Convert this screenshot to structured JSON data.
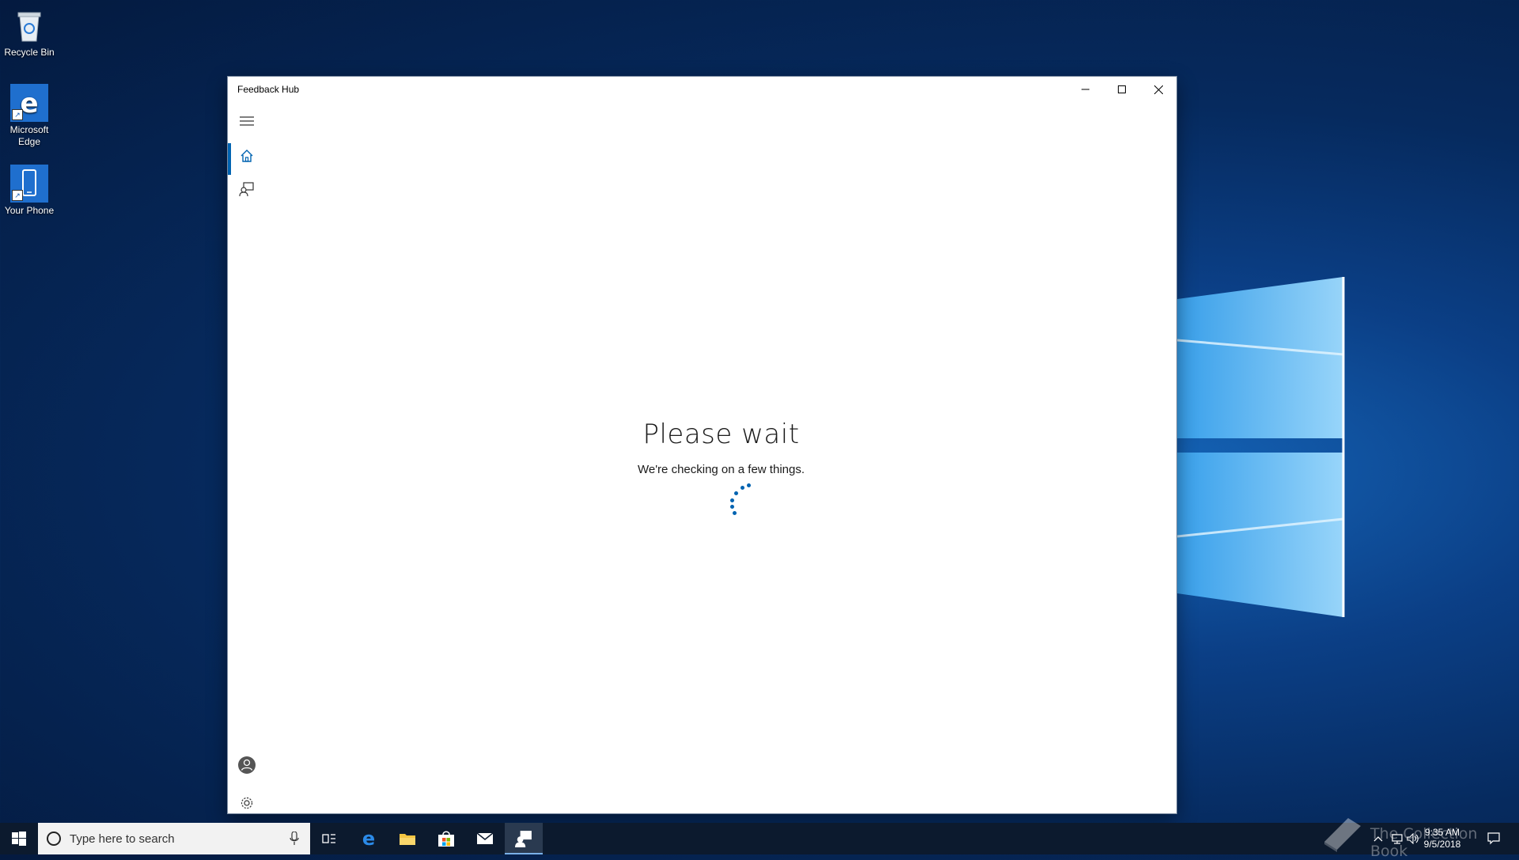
{
  "desktop": {
    "icons": [
      {
        "label": "Recycle Bin"
      },
      {
        "label": "Microsoft Edge"
      },
      {
        "label": "Your Phone"
      }
    ]
  },
  "window": {
    "title": "Feedback Hub",
    "nav": {
      "items": [
        {
          "icon": "hamburger-menu-icon"
        },
        {
          "icon": "home-icon",
          "active": true
        },
        {
          "icon": "feedback-icon"
        }
      ],
      "bottom": [
        {
          "icon": "account-icon"
        },
        {
          "icon": "settings-gear-icon"
        }
      ]
    },
    "content": {
      "heading": "Please wait",
      "message": "We're checking on a few things."
    },
    "accent_color": "#0063b1"
  },
  "taskbar": {
    "search_placeholder": "Type here to search",
    "pinned": [
      "task-view-icon",
      "edge-icon",
      "file-explorer-icon",
      "store-icon",
      "mail-icon",
      "feedback-hub-icon"
    ],
    "time": "9:35 AM",
    "date": "9/5/2018"
  },
  "watermark": "The Collection Book"
}
